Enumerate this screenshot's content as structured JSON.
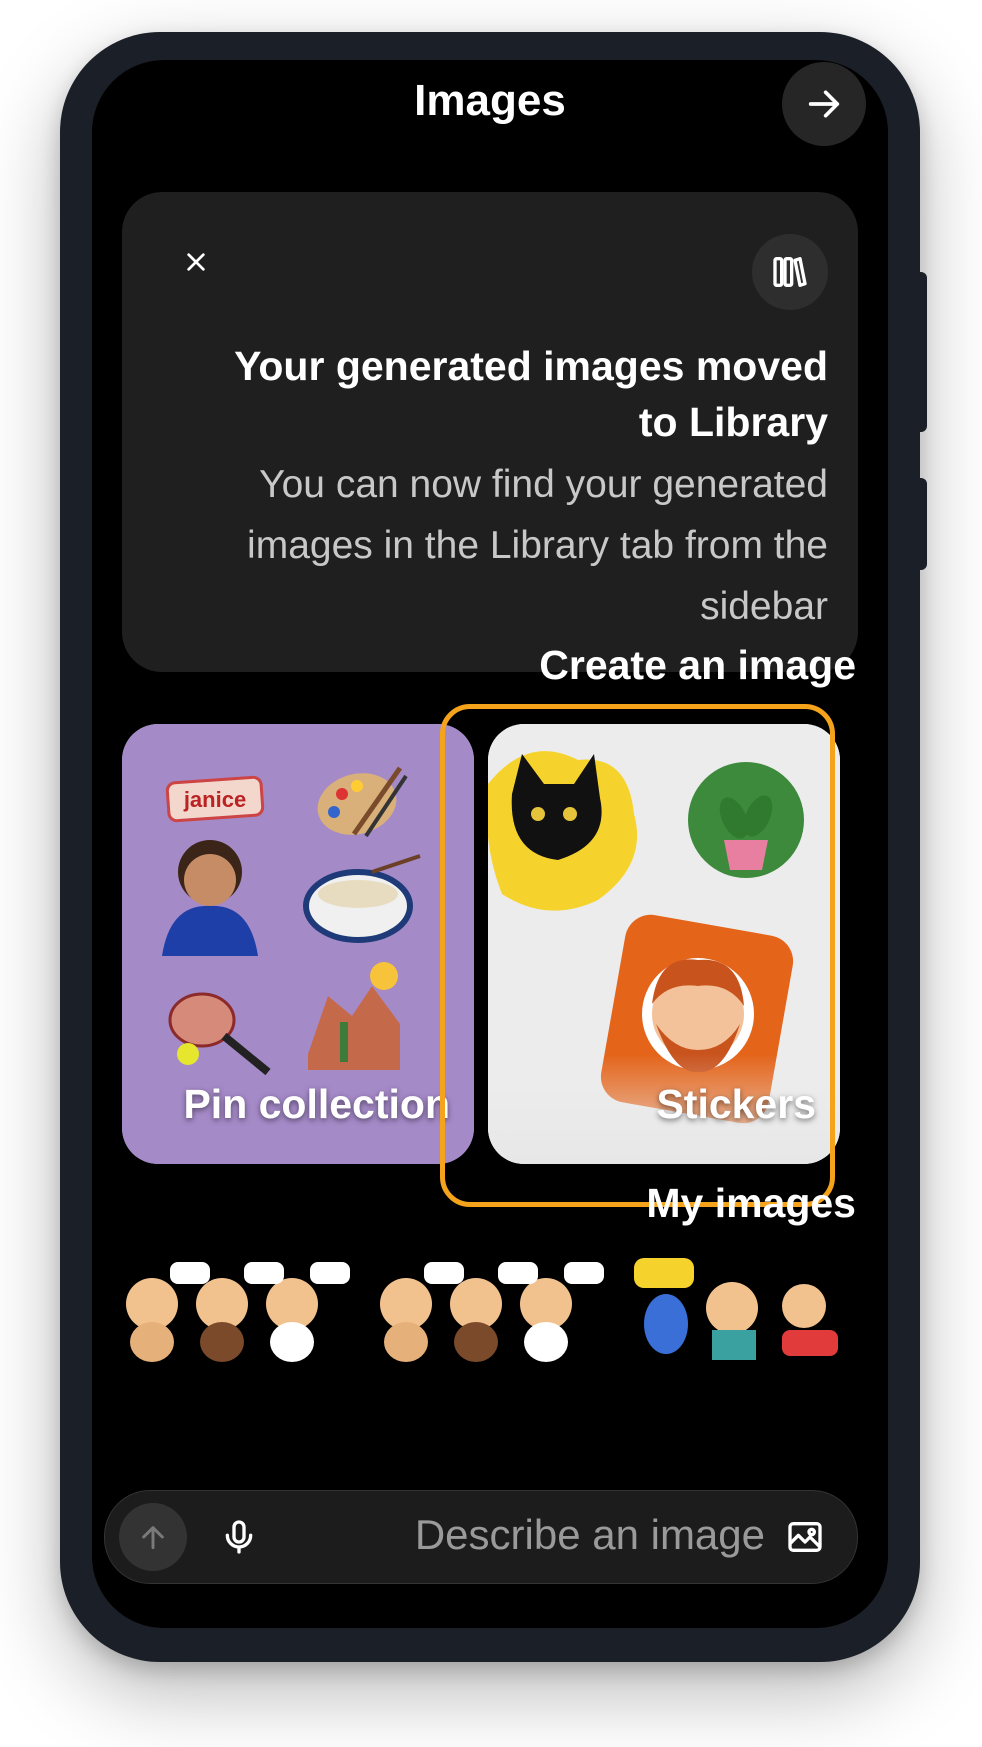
{
  "header": {
    "title": "Images",
    "nav_icon": "arrow-right-icon"
  },
  "notice": {
    "title": "Your generated images moved to Library",
    "body": "You can now find your generated images in the Library tab from the sidebar",
    "close_icon": "close-icon",
    "library_icon": "library-icon"
  },
  "create": {
    "heading": "Create an image",
    "tiles": [
      {
        "label": "Pin collection",
        "badge_text": "janice",
        "bg": "#a78bc9",
        "selected": false
      },
      {
        "label": "Stickers",
        "bg": "#e9e9e9",
        "selected": true
      }
    ],
    "selection_color": "#f4a31b"
  },
  "my_images": {
    "heading": "My images"
  },
  "composer": {
    "placeholder": "Describe an image",
    "send_icon": "arrow-up-icon",
    "mic_icon": "microphone-icon",
    "image_icon": "image-upload-icon"
  }
}
